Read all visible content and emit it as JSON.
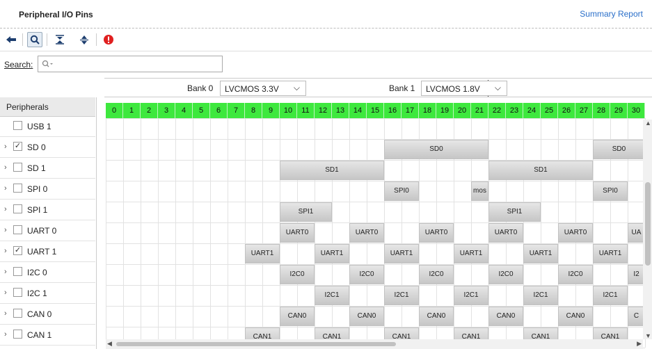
{
  "header": {
    "title": "Peripheral I/O Pins",
    "summary_link": "Summary Report"
  },
  "toolbar": {
    "items": [
      "back-icon",
      "search-icon",
      "collapse-all-icon",
      "expand-all-icon",
      "error-icon"
    ]
  },
  "search": {
    "label": "Search:",
    "value": "",
    "icon": "search-icon"
  },
  "left_panel": {
    "header": "Peripherals",
    "items": [
      {
        "label": "USB 1",
        "checked": false,
        "expandable": false
      },
      {
        "label": "SD 0",
        "checked": true,
        "expandable": true
      },
      {
        "label": "SD 1",
        "checked": false,
        "expandable": true
      },
      {
        "label": "SPI 0",
        "checked": false,
        "expandable": true
      },
      {
        "label": "SPI 1",
        "checked": false,
        "expandable": true
      },
      {
        "label": "UART 0",
        "checked": false,
        "expandable": true
      },
      {
        "label": "UART 1",
        "checked": true,
        "expandable": true
      },
      {
        "label": "I2C 0",
        "checked": false,
        "expandable": true
      },
      {
        "label": "I2C 1",
        "checked": false,
        "expandable": true
      },
      {
        "label": "CAN 0",
        "checked": false,
        "expandable": true
      },
      {
        "label": "CAN 1",
        "checked": false,
        "expandable": true
      }
    ]
  },
  "banks": [
    {
      "label": "Bank 0",
      "voltage": "LVCMOS 3.3V"
    },
    {
      "label": "Bank 1",
      "voltage": "LVCMOS 1.8V"
    }
  ],
  "pins": [
    "0",
    "1",
    "2",
    "3",
    "4",
    "5",
    "6",
    "7",
    "8",
    "9",
    "10",
    "11",
    "12",
    "13",
    "14",
    "15",
    "16",
    "17",
    "18",
    "19",
    "20",
    "21",
    "22",
    "23",
    "24",
    "25",
    "26",
    "27",
    "28",
    "29",
    "30"
  ],
  "rows": [
    {
      "blocks": []
    },
    {
      "blocks": [
        {
          "start": 16,
          "span": 6,
          "label": "SD0"
        },
        {
          "start": 28,
          "span": 3,
          "label": "SD0"
        }
      ]
    },
    {
      "blocks": [
        {
          "start": 10,
          "span": 6,
          "label": "SD1"
        },
        {
          "start": 22,
          "span": 6,
          "label": "SD1"
        }
      ]
    },
    {
      "blocks": [
        {
          "start": 16,
          "span": 2,
          "label": "SPI0"
        },
        {
          "start": 21,
          "span": 1,
          "label": "mos"
        },
        {
          "start": 28,
          "span": 2,
          "label": "SPI0"
        }
      ]
    },
    {
      "blocks": [
        {
          "start": 10,
          "span": 3,
          "label": "SPI1"
        },
        {
          "start": 22,
          "span": 3,
          "label": "SPI1"
        }
      ]
    },
    {
      "blocks": [
        {
          "start": 10,
          "span": 2,
          "label": "UART0"
        },
        {
          "start": 14,
          "span": 2,
          "label": "UART0"
        },
        {
          "start": 18,
          "span": 2,
          "label": "UART0"
        },
        {
          "start": 22,
          "span": 2,
          "label": "UART0"
        },
        {
          "start": 26,
          "span": 2,
          "label": "UART0"
        },
        {
          "start": 30,
          "span": 1,
          "label": "UA"
        }
      ]
    },
    {
      "blocks": [
        {
          "start": 8,
          "span": 2,
          "label": "UART1"
        },
        {
          "start": 12,
          "span": 2,
          "label": "UART1"
        },
        {
          "start": 16,
          "span": 2,
          "label": "UART1"
        },
        {
          "start": 20,
          "span": 2,
          "label": "UART1"
        },
        {
          "start": 24,
          "span": 2,
          "label": "UART1"
        },
        {
          "start": 28,
          "span": 2,
          "label": "UART1"
        }
      ]
    },
    {
      "blocks": [
        {
          "start": 10,
          "span": 2,
          "label": "I2C0"
        },
        {
          "start": 14,
          "span": 2,
          "label": "I2C0"
        },
        {
          "start": 18,
          "span": 2,
          "label": "I2C0"
        },
        {
          "start": 22,
          "span": 2,
          "label": "I2C0"
        },
        {
          "start": 26,
          "span": 2,
          "label": "I2C0"
        },
        {
          "start": 30,
          "span": 1,
          "label": "I2"
        }
      ]
    },
    {
      "blocks": [
        {
          "start": 12,
          "span": 2,
          "label": "I2C1"
        },
        {
          "start": 16,
          "span": 2,
          "label": "I2C1"
        },
        {
          "start": 20,
          "span": 2,
          "label": "I2C1"
        },
        {
          "start": 24,
          "span": 2,
          "label": "I2C1"
        },
        {
          "start": 28,
          "span": 2,
          "label": "I2C1"
        }
      ]
    },
    {
      "blocks": [
        {
          "start": 10,
          "span": 2,
          "label": "CAN0"
        },
        {
          "start": 14,
          "span": 2,
          "label": "CAN0"
        },
        {
          "start": 18,
          "span": 2,
          "label": "CAN0"
        },
        {
          "start": 22,
          "span": 2,
          "label": "CAN0"
        },
        {
          "start": 26,
          "span": 2,
          "label": "CAN0"
        },
        {
          "start": 30,
          "span": 1,
          "label": "C"
        }
      ]
    },
    {
      "blocks": [
        {
          "start": 8,
          "span": 2,
          "label": "CAN1"
        },
        {
          "start": 12,
          "span": 2,
          "label": "CAN1"
        },
        {
          "start": 16,
          "span": 2,
          "label": "CAN1"
        },
        {
          "start": 20,
          "span": 2,
          "label": "CAN1"
        },
        {
          "start": 24,
          "span": 2,
          "label": "CAN1"
        },
        {
          "start": 28,
          "span": 2,
          "label": "CAN1"
        }
      ]
    }
  ],
  "colors": {
    "pin_header": "#3ee83e",
    "link": "#2a6fc9",
    "error": "#e02020"
  }
}
